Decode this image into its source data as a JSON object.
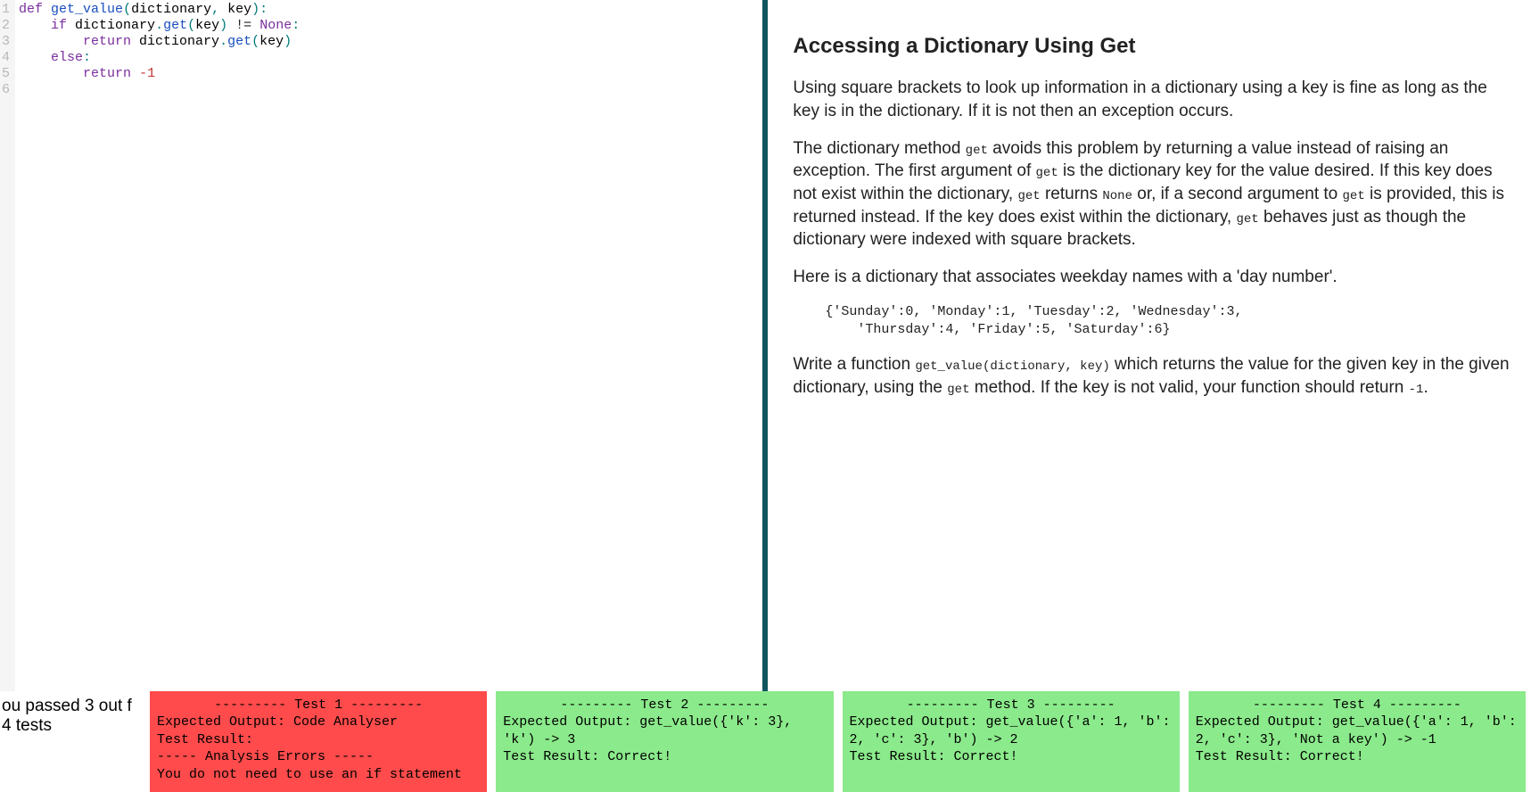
{
  "editor": {
    "line_numbers": [
      "1",
      "2",
      "3",
      "4",
      "5",
      "6"
    ],
    "code_plain": "def get_value(dictionary, key):\n    if dictionary.get(key) != None:\n        return dictionary.get(key)\n    else:\n        return -1\n"
  },
  "instructions": {
    "title": "Accessing a Dictionary Using Get",
    "p1": "Using square brackets to look up information in a dictionary using a key is fine as long as the key is in the dictionary. If it is not then an exception occurs.",
    "p2a": "The dictionary method ",
    "p2b": " avoids this problem by returning a value instead of raising an exception. The first argument of ",
    "p2c": " is the dictionary key for the value desired. If this key does not exist within the dictionary, ",
    "p2d": " returns ",
    "p2e": " or, if a second argument to ",
    "p2f": " is provided, this is returned instead. If the key does exist within the dictionary, ",
    "p2g": " behaves just as though the dictionary were indexed with square brackets.",
    "p3": "Here is a dictionary that associates weekday names with a 'day number'.",
    "codeblock": "{'Sunday':0, 'Monday':1, 'Tuesday':2, 'Wednesday':3,\n    'Thursday':4, 'Friday':5, 'Saturday':6}",
    "p4a": "Write a function ",
    "p4b": " which returns the value for the given key in the given dictionary, using the ",
    "p4c": " method. If the key is not valid, your function should return ",
    "p4d": ".",
    "code_get": "get",
    "code_none": "None",
    "code_sig": "get_value(dictionary, key)",
    "code_neg1": "-1"
  },
  "results": {
    "summary": "ou passed 3 out f 4 tests",
    "tests": [
      {
        "status": "fail",
        "header": "--------- Test 1 ---------",
        "lines": [
          "Expected Output: Code Analyser",
          "Test Result:",
          "----- Analysis Errors -----",
          "You do not need to use an if statement"
        ]
      },
      {
        "status": "pass",
        "header": "--------- Test 2 ---------",
        "lines": [
          "Expected Output: get_value({'k': 3}, 'k') -> 3",
          "Test Result: Correct!"
        ]
      },
      {
        "status": "pass",
        "header": "--------- Test 3 ---------",
        "lines": [
          "Expected Output: get_value({'a': 1, 'b': 2, 'c': 3}, 'b') -> 2",
          "Test Result: Correct!"
        ]
      },
      {
        "status": "pass",
        "header": "--------- Test 4 ---------",
        "lines": [
          "Expected Output: get_value({'a': 1, 'b': 2, 'c': 3}, 'Not a key') -> -1",
          "Test Result: Correct!"
        ]
      }
    ]
  }
}
